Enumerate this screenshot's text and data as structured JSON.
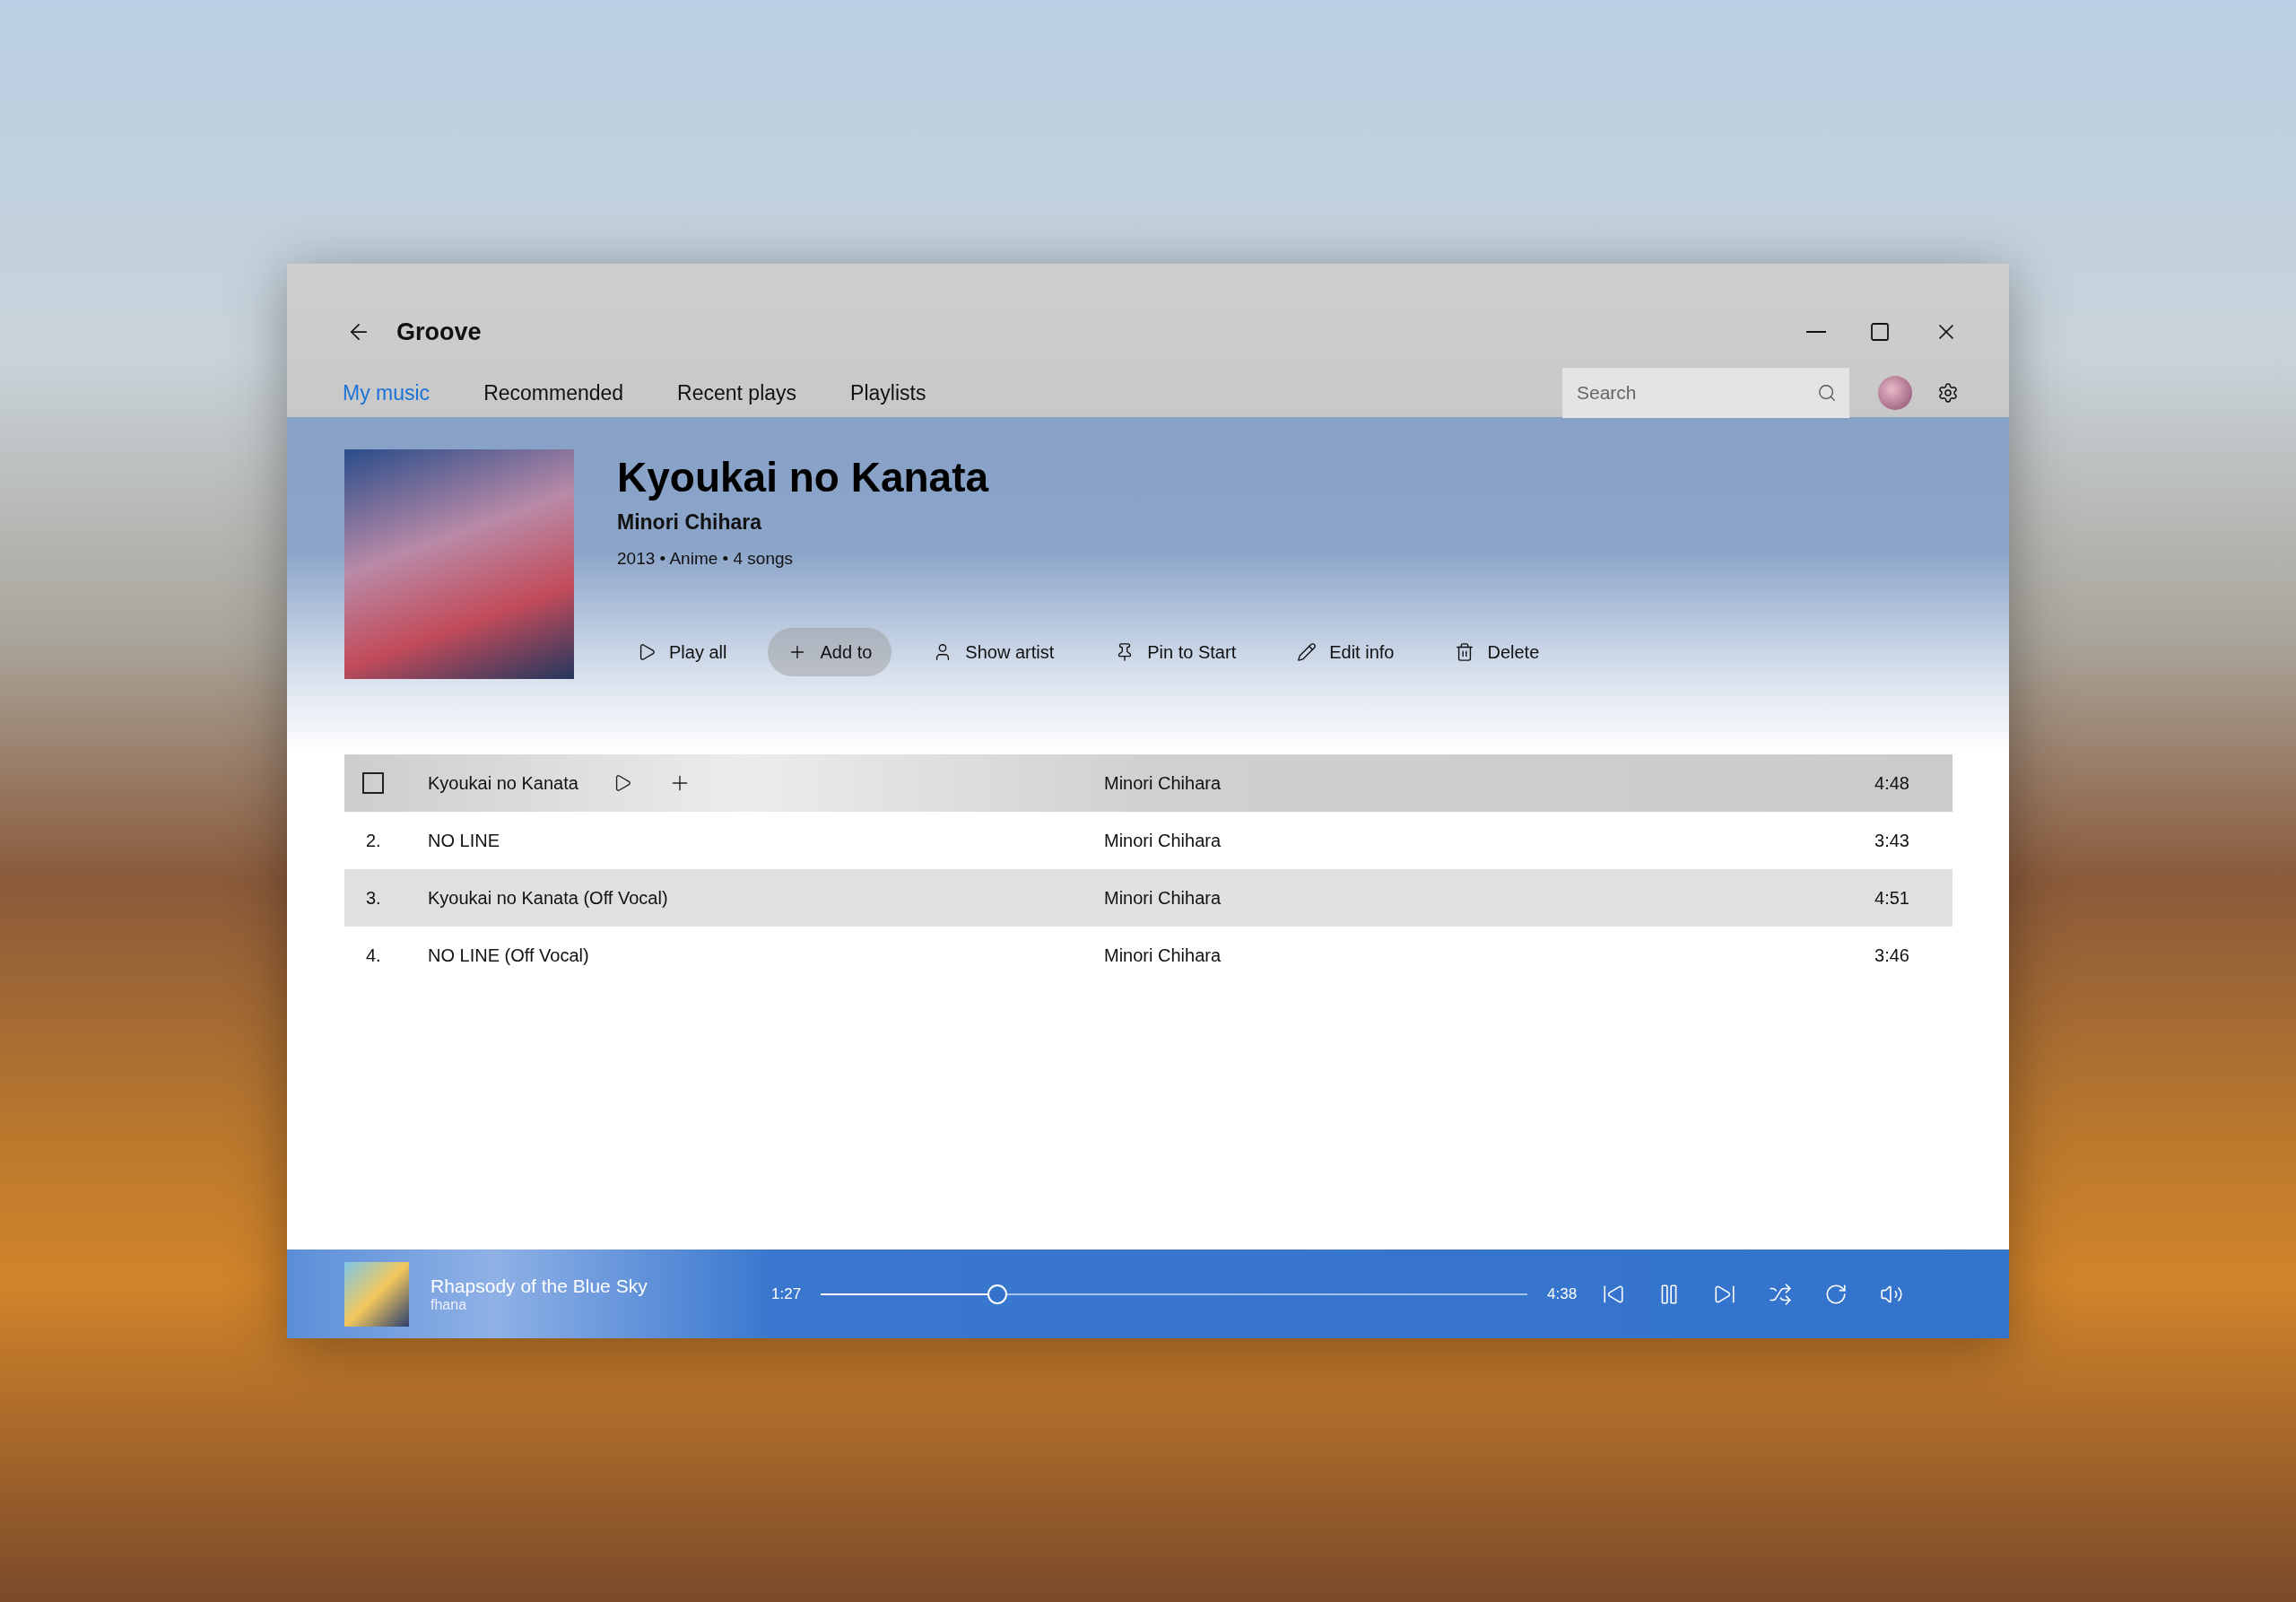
{
  "window": {
    "title": "Groove"
  },
  "tabs": [
    {
      "label": "My music",
      "selected": true
    },
    {
      "label": "Recommended",
      "selected": false
    },
    {
      "label": "Recent plays",
      "selected": false
    },
    {
      "label": "Playlists",
      "selected": false
    }
  ],
  "search": {
    "placeholder": "Search"
  },
  "album": {
    "title": "Kyoukai no Kanata",
    "artist": "Minori Chihara",
    "meta": "2013 • Anime • 4 songs"
  },
  "actions": [
    {
      "kind": "play",
      "label": "Play all",
      "hovered": false
    },
    {
      "kind": "add",
      "label": "Add to",
      "hovered": true
    },
    {
      "kind": "person",
      "label": "Show artist",
      "hovered": false
    },
    {
      "kind": "pin",
      "label": "Pin to Start",
      "hovered": false
    },
    {
      "kind": "edit",
      "label": "Edit info",
      "hovered": false
    },
    {
      "kind": "delete",
      "label": "Delete",
      "hovered": false
    }
  ],
  "tracks": [
    {
      "title": "Kyoukai no Kanata",
      "artist": "Minori Chihara",
      "duration": "4:48",
      "hovered": true,
      "checked": false
    },
    {
      "number": "2.",
      "title": "NO LINE",
      "artist": "Minori Chihara",
      "duration": "3:43",
      "hovered": false
    },
    {
      "number": "3.",
      "title": "Kyoukai no Kanata (Off Vocal)",
      "artist": "Minori Chihara",
      "duration": "4:51",
      "hovered": false
    },
    {
      "number": "4.",
      "title": "NO LINE (Off Vocal)",
      "artist": "Minori Chihara",
      "duration": "3:46",
      "hovered": false
    }
  ],
  "player": {
    "title": "Rhapsody of the Blue Sky",
    "artist": "fhana",
    "elapsed": "1:27",
    "total": "4:38",
    "level": 0.25
  }
}
